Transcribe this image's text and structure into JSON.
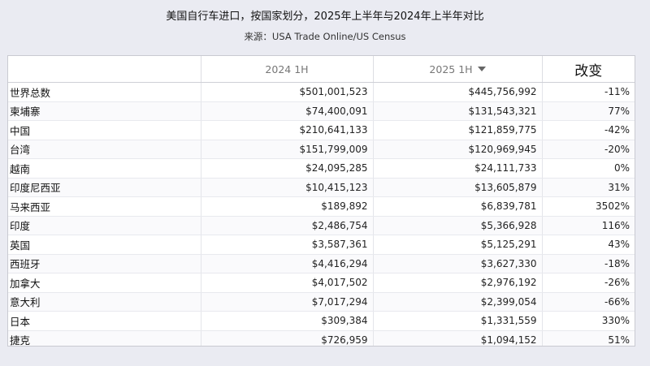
{
  "title": "美国自行车进口，按国家划分，2025年上半年与2024年上半年对比",
  "source": "来源：USA Trade Online/US Census",
  "chart_data": {
    "type": "table",
    "columns": [
      "",
      "2024 1H",
      "2025 1H",
      "改变"
    ],
    "sort_icon": "sort-descending-icon",
    "rows": [
      {
        "name": "世界总数",
        "y2024": "$501,001,523",
        "y2025": "$445,756,992",
        "change": "-11%"
      },
      {
        "name": "柬埔寨",
        "y2024": "$74,400,091",
        "y2025": "$131,543,321",
        "change": "77%"
      },
      {
        "name": "中国",
        "y2024": "$210,641,133",
        "y2025": "$121,859,775",
        "change": "-42%"
      },
      {
        "name": "台湾",
        "y2024": "$151,799,009",
        "y2025": "$120,969,945",
        "change": "-20%"
      },
      {
        "name": "越南",
        "y2024": "$24,095,285",
        "y2025": "$24,111,733",
        "change": "0%"
      },
      {
        "name": "印度尼西亚",
        "y2024": "$10,415,123",
        "y2025": "$13,605,879",
        "change": "31%"
      },
      {
        "name": "马来西亚",
        "y2024": "$189,892",
        "y2025": "$6,839,781",
        "change": "3502%"
      },
      {
        "name": "印度",
        "y2024": "$2,486,754",
        "y2025": "$5,366,928",
        "change": "116%"
      },
      {
        "name": "英国",
        "y2024": "$3,587,361",
        "y2025": "$5,125,291",
        "change": "43%"
      },
      {
        "name": "西班牙",
        "y2024": "$4,416,294",
        "y2025": "$3,627,330",
        "change": "-18%"
      },
      {
        "name": "加拿大",
        "y2024": "$4,017,502",
        "y2025": "$2,976,192",
        "change": "-26%"
      },
      {
        "name": "意大利",
        "y2024": "$7,017,294",
        "y2025": "$2,399,054",
        "change": "-66%"
      },
      {
        "name": "日本",
        "y2024": "$309,384",
        "y2025": "$1,331,559",
        "change": "330%"
      },
      {
        "name": "捷克",
        "y2024": "$726,959",
        "y2025": "$1,094,152",
        "change": "51%"
      }
    ]
  }
}
